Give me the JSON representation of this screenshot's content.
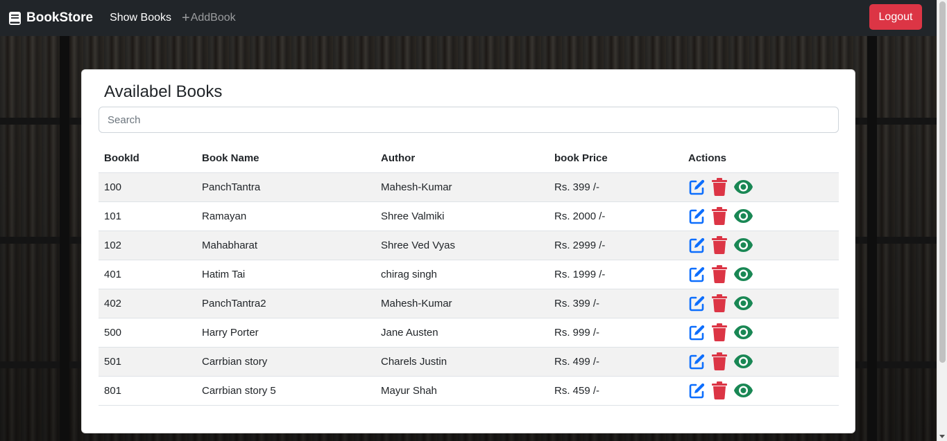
{
  "navbar": {
    "brand": "BookStore",
    "links": {
      "show_books": "Show Books",
      "add_book": "AddBook"
    },
    "logout_label": "Logout"
  },
  "card": {
    "title": "Availabel Books",
    "search": {
      "placeholder": "Search",
      "value": ""
    }
  },
  "table": {
    "headers": [
      "BookId",
      "Book Name",
      "Author",
      "book Price",
      "Actions"
    ],
    "rows": [
      {
        "id": "100",
        "name": "PanchTantra",
        "author": "Mahesh-Kumar",
        "price": "Rs. 399 /-"
      },
      {
        "id": "101",
        "name": "Ramayan",
        "author": "Shree Valmiki",
        "price": "Rs. 2000 /-"
      },
      {
        "id": "102",
        "name": "Mahabharat",
        "author": "Shree Ved Vyas",
        "price": "Rs. 2999 /-"
      },
      {
        "id": "401",
        "name": "Hatim Tai",
        "author": "chirag singh",
        "price": "Rs. 1999 /-"
      },
      {
        "id": "402",
        "name": "PanchTantra2",
        "author": "Mahesh-Kumar",
        "price": "Rs. 399 /-"
      },
      {
        "id": "500",
        "name": "Harry Porter",
        "author": "Jane Austen",
        "price": "Rs. 999 /-"
      },
      {
        "id": "501",
        "name": "Carrbian story",
        "author": "Charels Justin",
        "price": "Rs. 499 /-"
      },
      {
        "id": "801",
        "name": "Carrbian story 5",
        "author": "Mayur Shah",
        "price": "Rs. 459 /-"
      }
    ],
    "action_icons": [
      "edit-icon",
      "trash-icon",
      "eye-icon"
    ]
  },
  "colors": {
    "navbar": "#212529",
    "danger": "#dc3545",
    "edit": "#0d6efd",
    "view": "#198754"
  }
}
